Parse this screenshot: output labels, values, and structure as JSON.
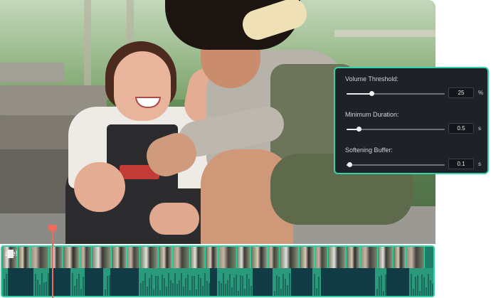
{
  "settings": [
    {
      "label": "Volume Threshold:",
      "value": "25",
      "unit": "%",
      "level": 0.25
    },
    {
      "label": "Minimum Duration:",
      "value": "0.5",
      "unit": "s",
      "level": 0.12
    },
    {
      "label": "Softening Buffer:",
      "value": "0.1",
      "unit": "s",
      "level": 0.03
    }
  ],
  "timeline": {
    "clip_label": "ale!",
    "playhead_color": "#f06a5b",
    "accent_color": "#2fd4a8"
  },
  "colors": {
    "panel_bg": "#1e2128",
    "waveform_bg": "#1f7e6a",
    "silent_segment": "#123c45"
  }
}
